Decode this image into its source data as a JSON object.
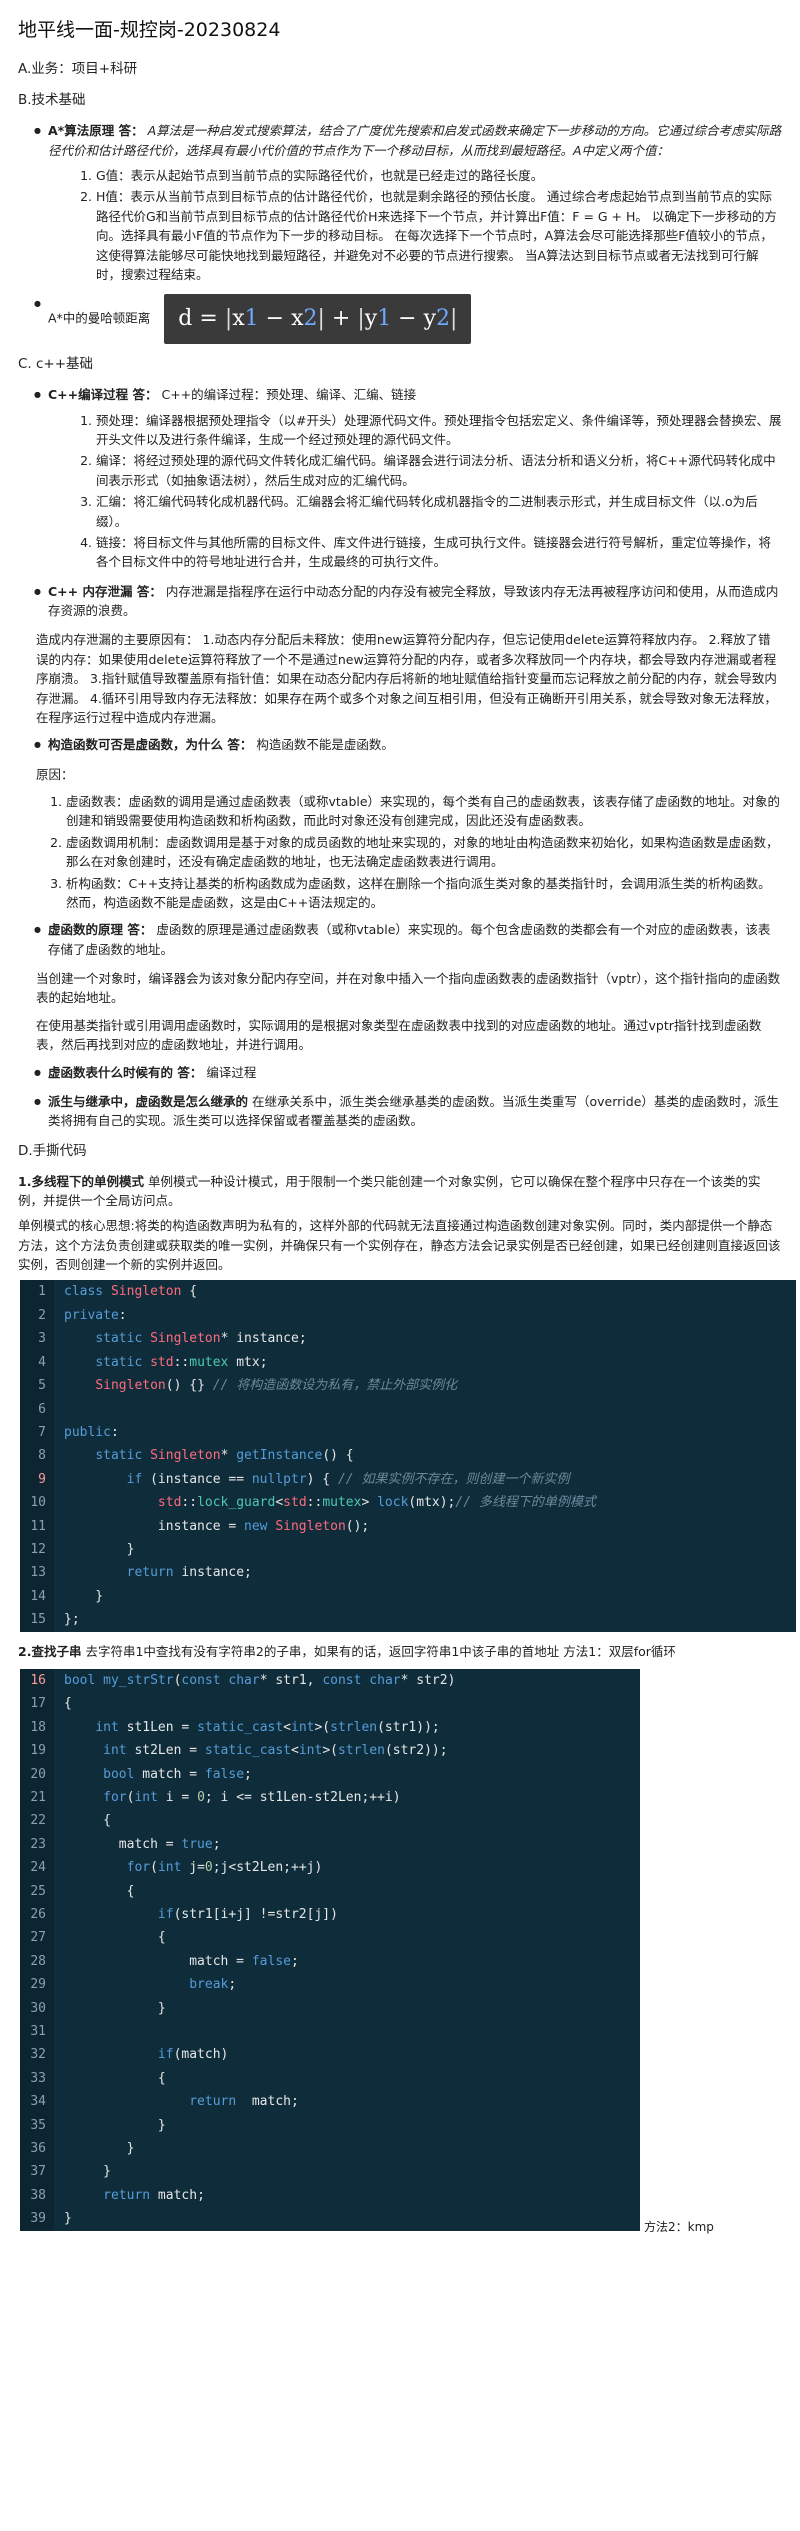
{
  "title": "地平线一面-规控岗-20230824",
  "sections": {
    "a": "A.业务：项目+科研",
    "b": "B.技术基础",
    "c": "C. c++基础",
    "d": "D.手撕代码"
  },
  "astar": {
    "head_label": "A*算法原理 答：",
    "head_text": "A算法是一种启发式搜索算法，结合了广度优先搜索和启发式函数来确定下一步移动的方向。它通过综合考虑实际路径代价和估计路径代价，选择具有最小代价值的节点作为下一个移动目标，从而找到最短路径。A中定义两个值：",
    "items": [
      "G值：表示从起始节点到当前节点的实际路径代价，也就是已经走过的路径长度。",
      "H值：表示从当前节点到目标节点的估计路径代价，也就是剩余路径的预估长度。 通过综合考虑起始节点到当前节点的实际路径代价G和当前节点到目标节点的估计路径代价H来选择下一个节点，并计算出F值：F = G + H。 以确定下一步移动的方向。选择具有最小F值的节点作为下一步的移动目标。 在每次选择下一个节点时，A算法会尽可能选择那些F值较小的节点，这使得算法能够尽可能快地找到最短路径，并避免对不必要的节点进行搜索。 当A算法达到目标节点或者无法找到可行解时，搜索过程结束。"
    ],
    "manhattan_label": "A*中的曼哈顿距离",
    "formula": "d = |x1 − x2| + |y1 − y2|"
  },
  "cpp": {
    "compile_label": "C++编译过程 答：",
    "compile_text": "C++的编译过程：预处理、编译、汇编、链接",
    "compile_items": [
      "预处理：编译器根据预处理指令（以#开头）处理源代码文件。预处理指令包括宏定义、条件编译等，预处理器会替换宏、展开头文件以及进行条件编译，生成一个经过预处理的源代码文件。",
      "编译：将经过预处理的源代码文件转化成汇编代码。编译器会进行词法分析、语法分析和语义分析，将C++源代码转化成中间表示形式（如抽象语法树），然后生成对应的汇编代码。",
      "汇编：将汇编代码转化成机器代码。汇编器会将汇编代码转化成机器指令的二进制表示形式，并生成目标文件（以.o为后缀）。",
      "链接：将目标文件与其他所需的目标文件、库文件进行链接，生成可执行文件。链接器会进行符号解析，重定位等操作，将各个目标文件中的符号地址进行合并，生成最终的可执行文件。"
    ],
    "leak_label": "C++ 内存泄漏 答：",
    "leak_text": "内存泄漏是指程序在运行中动态分配的内存没有被完全释放，导致该内存无法再被程序访问和使用，从而造成内存资源的浪费。",
    "leak_para": "造成内存泄漏的主要原因有： 1.动态内存分配后未释放：使用new运算符分配内存，但忘记使用delete运算符释放内存。 2.释放了错误的内存：如果使用delete运算符释放了一个不是通过new运算符分配的内存，或者多次释放同一个内存块，都会导致内存泄漏或者程序崩溃。 3.指针赋值导致覆盖原有指针值：如果在动态分配内存后将新的地址赋值给指针变量而忘记释放之前分配的内存，就会导致内存泄漏。 4.循环引用导致内存无法释放：如果存在两个或多个对象之间互相引用，但没有正确断开引用关系，就会导致对象无法释放，在程序运行过程中造成内存泄漏。",
    "ctor_label": "构造函数可否是虚函数，为什么 答：",
    "ctor_text": "构造函数不能是虚函数。",
    "ctor_reason": "原因：",
    "ctor_items": [
      "虚函数表：虚函数的调用是通过虚函数表（或称vtable）来实现的，每个类有自己的虚函数表，该表存储了虚函数的地址。对象的创建和销毁需要使用构造函数和析构函数，而此时对象还没有创建完成，因此还没有虚函数表。",
      "虚函数调用机制：虚函数调用是基于对象的成员函数的地址来实现的，对象的地址由构造函数来初始化，如果构造函数是虚函数，那么在对象创建时，还没有确定虚函数的地址，也无法确定虚函数表进行调用。",
      "析构函数：C++支持让基类的析构函数成为虚函数，这样在删除一个指向派生类对象的基类指针时，会调用派生类的析构函数。然而，构造函数不能是虚函数，这是由C++语法规定的。"
    ],
    "virt_label": "虚函数的原理 答：",
    "virt_text": "虚函数的原理是通过虚函数表（或称vtable）来实现的。每个包含虚函数的类都会有一个对应的虚函数表，该表存储了虚函数的地址。",
    "virt_para1": "当创建一个对象时，编译器会为该对象分配内存空间，并在对象中插入一个指向虚函数表的虚函数指针（vptr），这个指针指向的虚函数表的起始地址。",
    "virt_para2": "在使用基类指针或引用调用虚函数时，实际调用的是根据对象类型在虚函数表中找到的对应虚函数的地址。通过vptr指针找到虚函数表，然后再找到对应的虚函数地址，并进行调用。",
    "when_label": "虚函数表什么时候有的 答：",
    "when_text": "编译过程",
    "derive_label": "派生与继承中，虚函数是怎么继承的",
    "derive_text": "在继承关系中，派生类会继承基类的虚函数。当派生类重写（override）基类的虚函数时，派生类将拥有自己的实现。派生类可以选择保留或者覆盖基类的虚函数。"
  },
  "handcode": {
    "q1_label": "1.多线程下的单例模式",
    "q1_text": "单例模式一种设计模式，用于限制一个类只能创建一个对象实例，它可以确保在整个程序中只存在一个该类的实例，并提供一个全局访问点。",
    "q1_para": "单例模式的核心思想:将类的构造函数声明为私有的，这样外部的代码就无法直接通过构造函数创建对象实例。同时，类内部提供一个静态方法，这个方法负责创建或获取类的唯一实例，并确保只有一个实例存在，静态方法会记录实例是否已经创建，如果已经创建则直接返回该实例，否则创建一个新的实例并返回。",
    "q2_label": "2.查找子串",
    "q2_text": "去字符串1中查找有没有字符串2的子串，如果有的话，返回字符串1中该子串的首地址 方法1：双层for循环",
    "method2": "方法2：kmp"
  },
  "code1": {
    "start": 1,
    "active": 9,
    "lines": [
      "class Singleton {",
      "private:",
      "    static Singleton* instance;",
      "    static std::mutex mtx;",
      "    Singleton() {} // 将构造函数设为私有，禁止外部实例化",
      "",
      "public:",
      "    static Singleton* getInstance() {",
      "        if (instance == nullptr) { // 如果实例不存在，则创建一个新实例",
      "            std::lock_guard<std::mutex> lock(mtx);// 多线程下的单例模式",
      "            instance = new Singleton();",
      "        }",
      "        return instance;",
      "    }",
      "};"
    ]
  },
  "code2": {
    "start": 16,
    "active": 16,
    "lines": [
      "bool my_strStr(const char* str1, const char* str2)",
      "{",
      "    int st1Len = static_cast<int>(strlen(str1));",
      "     int st2Len = static_cast<int>(strlen(str2));",
      "     bool match = false;",
      "     for(int i = 0; i <= st1Len-st2Len;++i)",
      "     {",
      "       match = true;",
      "        for(int j=0;j<st2Len;++j)",
      "        {",
      "            if(str1[i+j] !=str2[j])",
      "            {",
      "                match = false;",
      "                break;",
      "            }",
      "",
      "            if(match)",
      "            {",
      "                return  match;",
      "            }",
      "        }",
      "     }",
      "     return match;",
      "}"
    ]
  }
}
